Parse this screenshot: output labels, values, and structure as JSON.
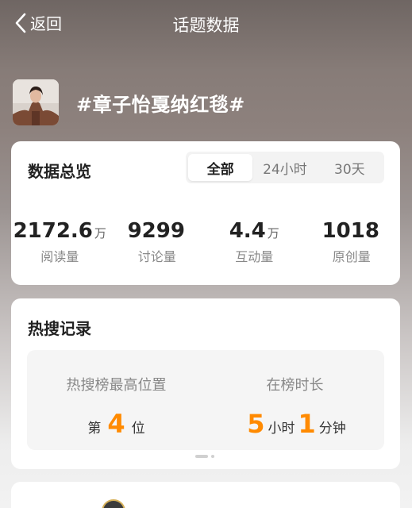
{
  "nav": {
    "back_label": "返回",
    "title": "话题数据"
  },
  "topic": {
    "title": "#章子怡戛纳红毯#"
  },
  "overview": {
    "title": "数据总览",
    "tabs": [
      {
        "label": "全部",
        "active": true
      },
      {
        "label": "24小时",
        "active": false
      },
      {
        "label": "30天",
        "active": false
      }
    ],
    "stats": [
      {
        "value": "2172.6",
        "unit": "万",
        "label": "阅读量"
      },
      {
        "value": "9299",
        "unit": "",
        "label": "讨论量"
      },
      {
        "value": "4.4",
        "unit": "万",
        "label": "互动量"
      },
      {
        "value": "1018",
        "unit": "",
        "label": "原创量"
      }
    ]
  },
  "hot_search": {
    "title": "热搜记录",
    "peak_label": "热搜榜最高位置",
    "peak_prefix": "第",
    "peak_value": "4",
    "peak_suffix": "位",
    "duration_label": "在榜时长",
    "duration_hours": "5",
    "duration_hours_unit": "小时",
    "duration_minutes": "1",
    "duration_minutes_unit": "分钟"
  },
  "colors": {
    "accent": "#ff8a00",
    "card_bg": "#ffffff"
  },
  "icons": {
    "back": "chevron-left-icon"
  }
}
